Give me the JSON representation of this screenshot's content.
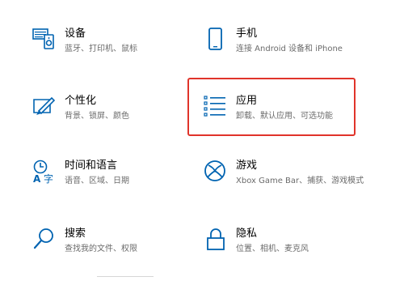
{
  "settings": {
    "tiles": [
      {
        "id": "devices",
        "title": "设备",
        "description": "蓝牙、打印机、鼠标",
        "icon": "devices-icon"
      },
      {
        "id": "phone",
        "title": "手机",
        "description": "连接 Android 设备和 iPhone",
        "icon": "phone-icon"
      },
      {
        "id": "personalization",
        "title": "个性化",
        "description": "背景、锁屏、颜色",
        "icon": "personalization-icon"
      },
      {
        "id": "apps",
        "title": "应用",
        "description": "卸载、默认应用、可选功能",
        "icon": "apps-list-icon"
      },
      {
        "id": "time-language",
        "title": "时间和语言",
        "description": "语音、区域、日期",
        "icon": "time-language-icon"
      },
      {
        "id": "gaming",
        "title": "游戏",
        "description": "Xbox Game Bar、捕获、游戏模式",
        "icon": "xbox-icon"
      },
      {
        "id": "search",
        "title": "搜索",
        "description": "查找我的文件、权限",
        "icon": "search-icon"
      },
      {
        "id": "privacy",
        "title": "隐私",
        "description": "位置、相机、麦克风",
        "icon": "lock-icon"
      }
    ]
  },
  "colors": {
    "accent": "#0063b1",
    "highlight_border": "#e0342a",
    "description_text": "#6b6b6b"
  }
}
